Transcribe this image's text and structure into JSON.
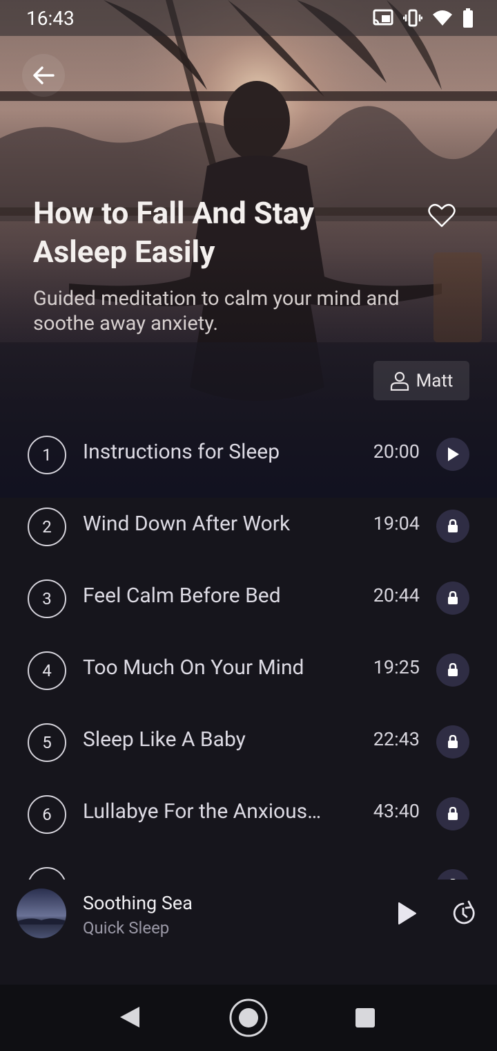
{
  "status_bar": {
    "time": "16:43"
  },
  "header": {
    "title": "How to Fall And Stay Asleep Easily",
    "subtitle": "Guided meditation to calm your mind and soothe away anxiety.",
    "author": "Matt"
  },
  "tracks": [
    {
      "number": "1",
      "name": "Instructions for Sleep",
      "duration": "20:00",
      "action": "play-icon"
    },
    {
      "number": "2",
      "name": "Wind Down After Work",
      "duration": "19:04",
      "action": "lock-icon"
    },
    {
      "number": "3",
      "name": "Feel Calm Before Bed",
      "duration": "20:44",
      "action": "lock-icon"
    },
    {
      "number": "4",
      "name": "Too Much On Your Mind",
      "duration": "19:25",
      "action": "lock-icon"
    },
    {
      "number": "5",
      "name": "Sleep Like A Baby",
      "duration": "22:43",
      "action": "lock-icon"
    },
    {
      "number": "6",
      "name": "Lullabye For the Anxious…",
      "duration": "43:40",
      "action": "lock-icon"
    },
    {
      "number": "7",
      "name": "",
      "duration": "",
      "action": "lock-icon"
    }
  ],
  "mini_player": {
    "title": "Soothing Sea",
    "subtitle": "Quick Sleep"
  },
  "colors": {
    "background": "#16151c",
    "accent_circle": "#2f2d44",
    "hero_tint": "#5a4444"
  }
}
